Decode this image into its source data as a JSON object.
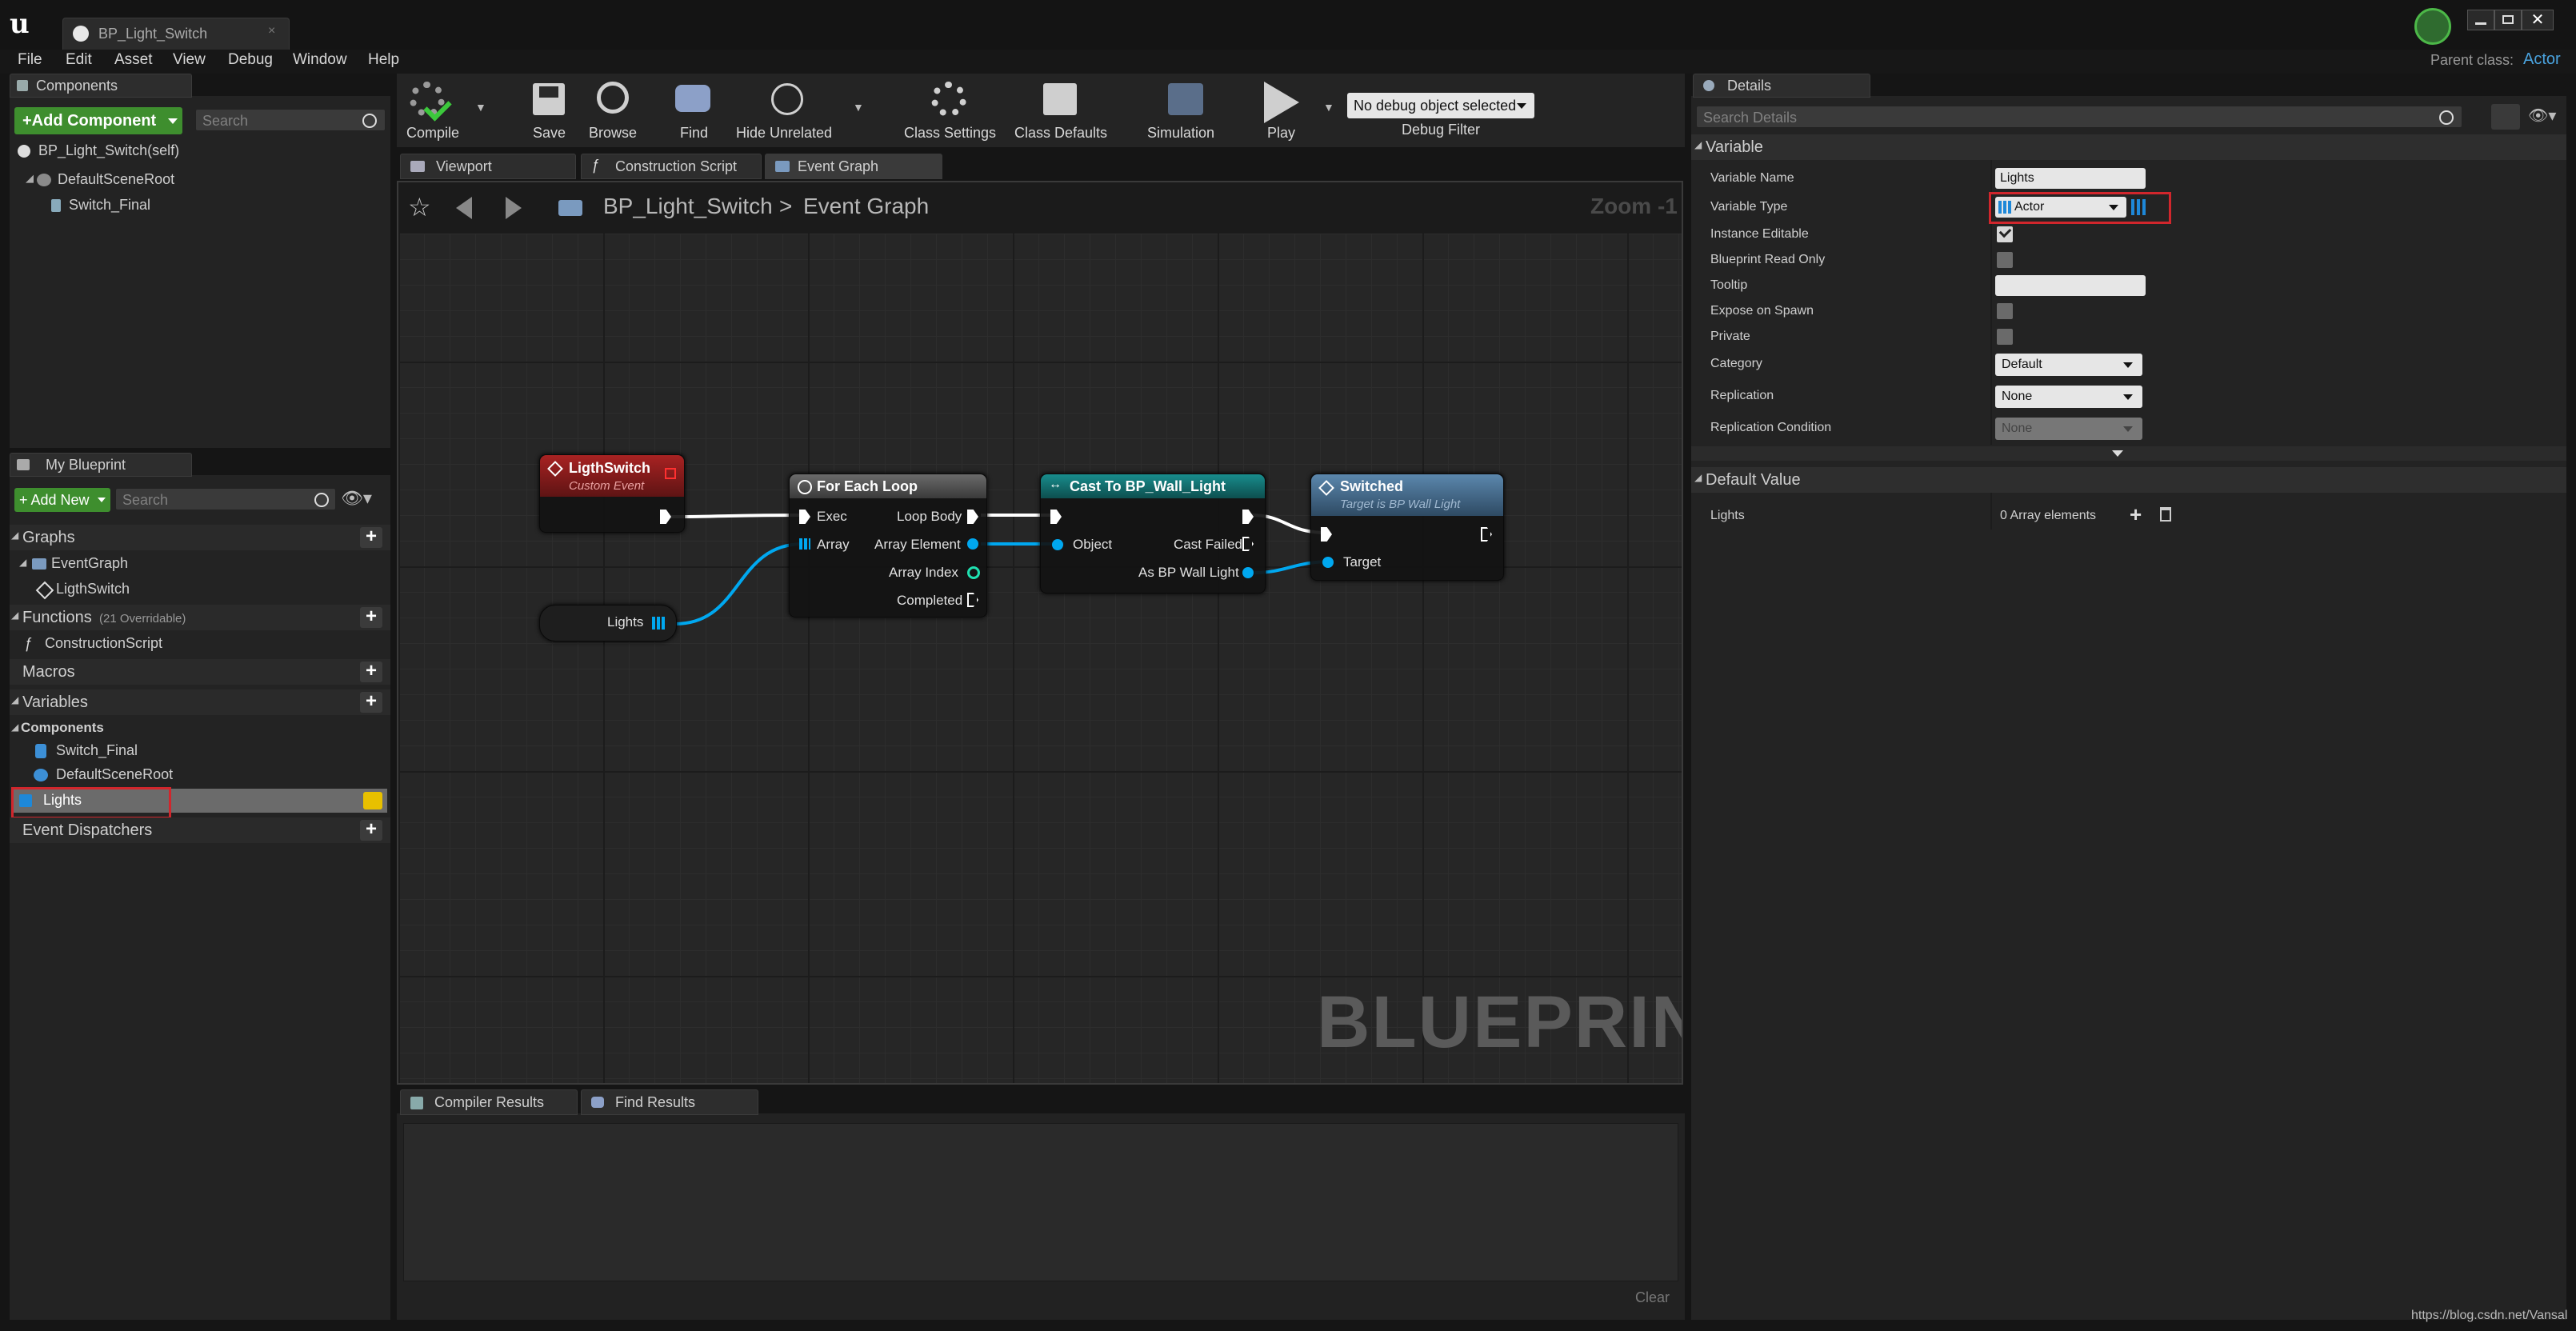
{
  "window": {
    "tab_title": "BP_Light_Switch",
    "parent_class_label": "Parent class:",
    "parent_class_value": "Actor"
  },
  "menu": [
    "File",
    "Edit",
    "Asset",
    "View",
    "Debug",
    "Window",
    "Help"
  ],
  "components_panel": {
    "tab": "Components",
    "add_button": "+Add Component",
    "search_placeholder": "Search",
    "self_item": "BP_Light_Switch(self)",
    "tree": [
      "DefaultSceneRoot",
      "Switch_Final"
    ]
  },
  "toolbar": {
    "compile": "Compile",
    "save": "Save",
    "browse": "Browse",
    "find": "Find",
    "hide_unrelated": "Hide Unrelated",
    "class_settings": "Class Settings",
    "class_defaults": "Class Defaults",
    "simulation": "Simulation",
    "play": "Play",
    "debug_object": "No debug object selected",
    "debug_filter": "Debug Filter"
  },
  "editor_tabs": [
    "Viewport",
    "Construction Script",
    "Event Graph"
  ],
  "breadcrumb": {
    "root": "BP_Light_Switch",
    "separator": ">",
    "current": "Event Graph",
    "zoom": "Zoom -1"
  },
  "watermark": "BLUEPRINT",
  "nodes": {
    "custom_event": {
      "title": "LigthSwitch",
      "subtitle": "Custom Event"
    },
    "for_each": {
      "title": "For Each Loop",
      "exec": "Exec",
      "array": "Array",
      "loop_body": "Loop Body",
      "array_element": "Array Element",
      "array_index": "Array Index",
      "completed": "Completed"
    },
    "cast": {
      "title": "Cast To BP_Wall_Light",
      "object": "Object",
      "cast_failed": "Cast Failed",
      "as_output": "As BP Wall Light"
    },
    "switched": {
      "title": "Switched",
      "subtitle": "Target is BP Wall Light",
      "target": "Target"
    },
    "lights_getter": {
      "label": "Lights"
    }
  },
  "my_blueprint": {
    "tab": "My Blueprint",
    "add_new": "+ Add New",
    "search_placeholder": "Search",
    "graphs": "Graphs",
    "event_graph": "EventGraph",
    "ligth_switch": "LigthSwitch",
    "functions": "Functions",
    "functions_note": "(21 Overridable)",
    "construction_script": "ConstructionScript",
    "macros": "Macros",
    "variables": "Variables",
    "components": "Components",
    "var_switch_final": "Switch_Final",
    "var_default_root": "DefaultSceneRoot",
    "var_lights": "Lights",
    "event_dispatchers": "Event Dispatchers"
  },
  "bottom_tabs": [
    "Compiler Results",
    "Find Results"
  ],
  "clear_button": "Clear",
  "details": {
    "tab": "Details",
    "search_placeholder": "Search Details",
    "variable_section": "Variable",
    "rows": {
      "variable_name": {
        "label": "Variable Name",
        "value": "Lights"
      },
      "variable_type": {
        "label": "Variable Type",
        "value": "Actor"
      },
      "instance_editable": {
        "label": "Instance Editable",
        "checked": true
      },
      "blueprint_read_only": {
        "label": "Blueprint Read Only",
        "checked": false
      },
      "tooltip": {
        "label": "Tooltip",
        "value": ""
      },
      "expose_on_spawn": {
        "label": "Expose on Spawn",
        "checked": false
      },
      "private": {
        "label": "Private",
        "checked": false
      },
      "category": {
        "label": "Category",
        "value": "Default"
      },
      "replication": {
        "label": "Replication",
        "value": "None"
      },
      "replication_condition": {
        "label": "Replication Condition",
        "value": "None"
      }
    },
    "default_value_section": "Default Value",
    "default_lights_label": "Lights",
    "default_lights_value": "0 Array elements"
  },
  "watermark_url": "https://blog.csdn.net/Vansal",
  "colors": {
    "accent_green": "#3e8e2e",
    "exec_white": "#ffffff",
    "object_blue": "#00a8f0",
    "int_green": "#1fe0b0",
    "event_red": "#8c1a1a",
    "cast_teal": "#126b6b",
    "function_blue": "#3e6f96",
    "highlight_red": "#d1262c"
  }
}
